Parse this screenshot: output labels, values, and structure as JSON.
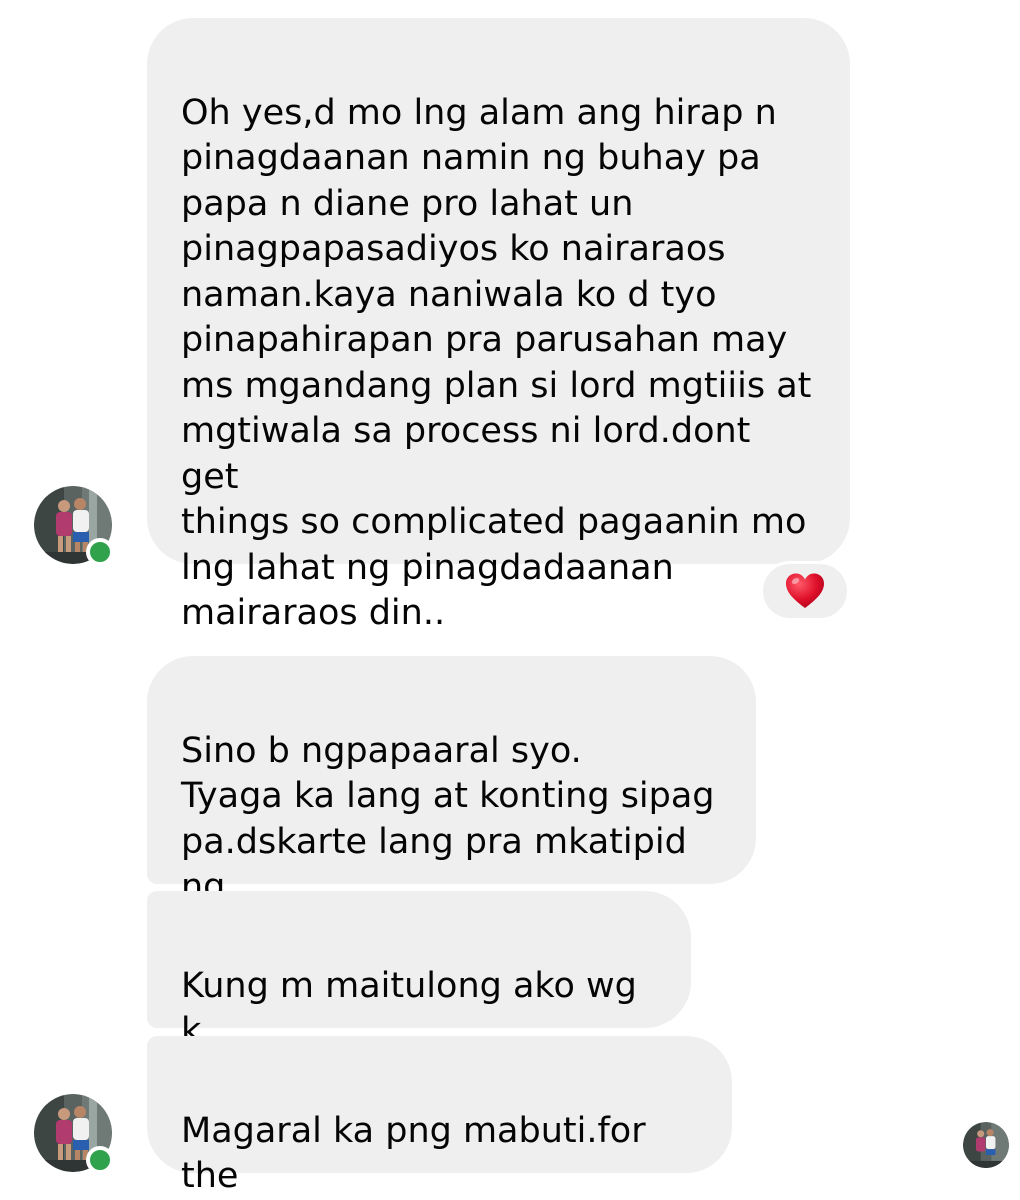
{
  "messages": [
    {
      "text": "Oh yes,d mo lng alam ang hirap n\npinagdaanan namin ng buhay pa\npapa n diane pro lahat un\npinagpapasadiyos ko nairaraos\nnaman.kaya naniwala ko d tyo\npinapahirapan pra parusahan may\nms mgandang plan si lord mgtiiis at\nmgtiwala sa process ni lord.dont get\nthings so complicated pagaanin mo\nlng lahat ng pinagdadaanan\nmairaraos din.."
    },
    {
      "text": "Sino b ngpapaaral syo.\nTyaga ka lang at konting sipag\npa.dskarte lang pra mkatipid ng\nkonti."
    },
    {
      "text": "Kung m maitulong ako wg k\nmahiya.mgsabi."
    },
    {
      "text": "Magaral ka png mabuti.for the\nfuture."
    }
  ],
  "reaction": {
    "icon": "heart-icon",
    "color": "#e0112b"
  },
  "sender": {
    "avatar_icon": "sender-avatar",
    "online_color": "#31a24c"
  },
  "colors": {
    "bubble": "#efefef",
    "text": "#050505",
    "background": "#ffffff"
  }
}
